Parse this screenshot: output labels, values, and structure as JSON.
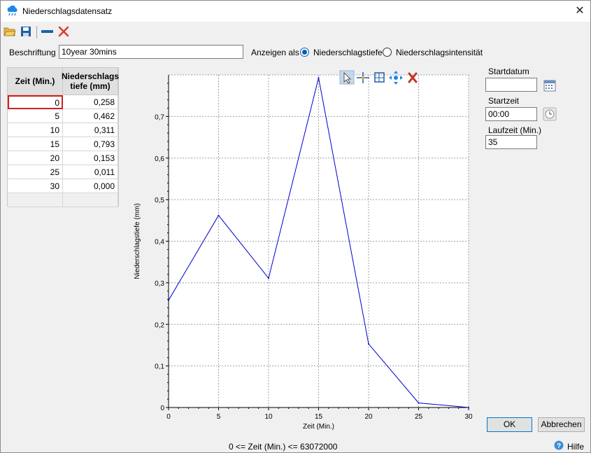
{
  "window": {
    "title": "Niederschlagsdatensatz"
  },
  "form": {
    "beschriftung_label": "Beschriftung",
    "beschriftung_value": "10year 30mins",
    "anzeigen_label": "Anzeigen als",
    "option_tiefe": "Niederschlagstiefe",
    "option_intensitaet": "Niederschlagsintensität",
    "selected_option": "Niederschlagstiefe"
  },
  "table": {
    "col1_header": "Zeit (Min.)",
    "col2_header_line1": "Niederschlags",
    "col2_header_line2": "tiefe (mm)",
    "rows": [
      {
        "zeit": "0",
        "tiefe": "0,258"
      },
      {
        "zeit": "5",
        "tiefe": "0,462"
      },
      {
        "zeit": "10",
        "tiefe": "0,311"
      },
      {
        "zeit": "15",
        "tiefe": "0,793"
      },
      {
        "zeit": "20",
        "tiefe": "0,153"
      },
      {
        "zeit": "25",
        "tiefe": "0,011"
      },
      {
        "zeit": "30",
        "tiefe": "0,000"
      }
    ]
  },
  "side": {
    "startdatum_label": "Startdatum",
    "startdatum_value": "",
    "startzeit_label": "Startzeit",
    "startzeit_value": "00:00",
    "laufzeit_label": "Laufzeit (Min.)",
    "laufzeit_value": "35"
  },
  "buttons": {
    "ok": "OK",
    "cancel": "Abbrechen",
    "help": "Hilfe"
  },
  "status": {
    "range_text": "0 <= Zeit (Min.) <= 63072000"
  },
  "colors": {
    "series": "#0000cc",
    "accent": "#005fb8",
    "selected_cell": "#d21f1f"
  },
  "chart_data": {
    "type": "line",
    "x": [
      0,
      5,
      10,
      15,
      20,
      25,
      30
    ],
    "series": [
      {
        "values": [
          0.258,
          0.462,
          0.311,
          0.793,
          0.153,
          0.011,
          0.0
        ]
      }
    ],
    "xlabel": "Zeit (Min.)",
    "ylabel": "Niederschlagstiefe (mm)",
    "xlim": [
      0,
      30
    ],
    "ylim": [
      0,
      0.8
    ],
    "xticks": [
      0,
      5,
      10,
      15,
      20,
      25,
      30
    ],
    "yticks": [
      "0",
      "0,1",
      "0,2",
      "0,3",
      "0,4",
      "0,5",
      "0,6",
      "0,7"
    ],
    "grid": true
  }
}
